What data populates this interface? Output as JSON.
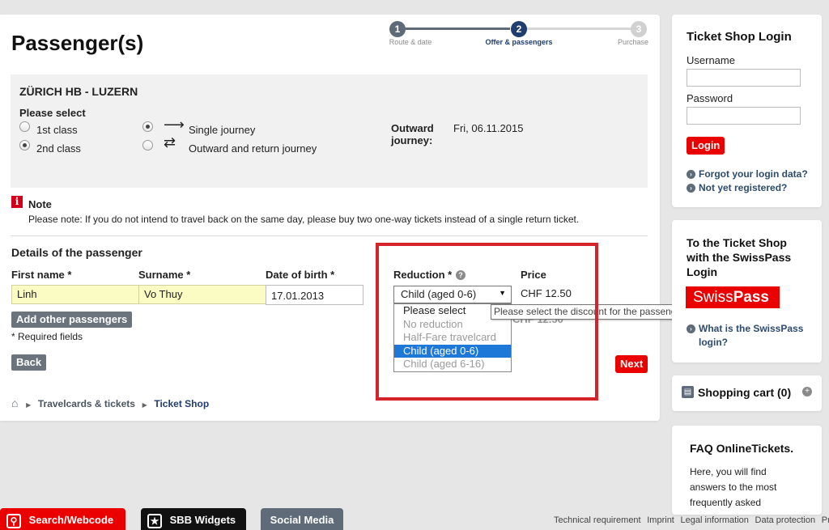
{
  "page_title": "Passenger(s)",
  "steps": [
    {
      "number": "1",
      "label": "Route & date",
      "state": "done"
    },
    {
      "number": "2",
      "label": "Offer & passengers",
      "state": "active"
    },
    {
      "number": "3",
      "label": "Purchase",
      "state": "todo"
    }
  ],
  "journey": {
    "route": "ZÜRICH HB - LUZERN",
    "please_select": "Please select",
    "class_options": [
      "1st class",
      "2nd class"
    ],
    "selected_class": "2nd class",
    "journey_options": [
      "Single journey",
      "Outward and return journey"
    ],
    "selected_journey": "Single journey",
    "outward_label_line1": "Outward",
    "outward_label_line2": "journey:",
    "outward_date": "Fri, 06.11.2015"
  },
  "note": {
    "title": "Note",
    "text": "Please note: If you do not intend to travel back on the same day, please buy two one-way tickets instead of a single return ticket."
  },
  "passenger": {
    "section_title": "Details of the passenger",
    "first_name_label": "First name *",
    "surname_label": "Surname *",
    "dob_label": "Date of birth  *",
    "reduction_label": "Reduction *",
    "price_label": "Price",
    "first_name": "Linh",
    "surname": "Vo Thuy",
    "dob": "17.01.2013",
    "reduction_value": "Child (aged 0-6)",
    "price": "CHF 12.50",
    "price_obscured": "CHF 12.50",
    "add_other": "Add other passengers",
    "required": "* Required fields",
    "reduction_options": [
      "Please select",
      "No reduction",
      "Half-Fare travelcard",
      "Child (aged 0-6)",
      "Child (aged 6-16)"
    ],
    "tooltip": "Please select the discount for the passenger."
  },
  "actions": {
    "back": "Back",
    "next": "Next"
  },
  "breadcrumb": [
    "Travelcards & tickets",
    "Ticket Shop"
  ],
  "login": {
    "title": "Ticket Shop Login",
    "username_label": "Username",
    "password_label": "Password",
    "login_button": "Login",
    "forgot": "Forgot your login data?",
    "register": "Not yet registered?"
  },
  "swisspass": {
    "title_line1": "To the Ticket Shop",
    "title_line2": "with the SwissPass",
    "title_line3": "Login",
    "logo_text": "SwissPass",
    "what_line1": "What is the SwissPass",
    "what_line2": "login?"
  },
  "cart": {
    "label": "Shopping cart (0)"
  },
  "faq": {
    "title": "FAQ OnlineTickets.",
    "line1": "Here, you will find",
    "line2": "answers to the most",
    "line3": "frequently asked"
  },
  "footer": {
    "search": "Search/Webcode",
    "widgets": "SBB Widgets",
    "social": "Social Media",
    "links": [
      "Technical requirement",
      "Imprint",
      "Legal information",
      "Data protection",
      "Print"
    ]
  },
  "colors": {
    "brand_red": "#eb0000",
    "step_blue": "#2a4a74",
    "highlight_red": "#d4232b",
    "selected_blue": "#1e78d8"
  }
}
